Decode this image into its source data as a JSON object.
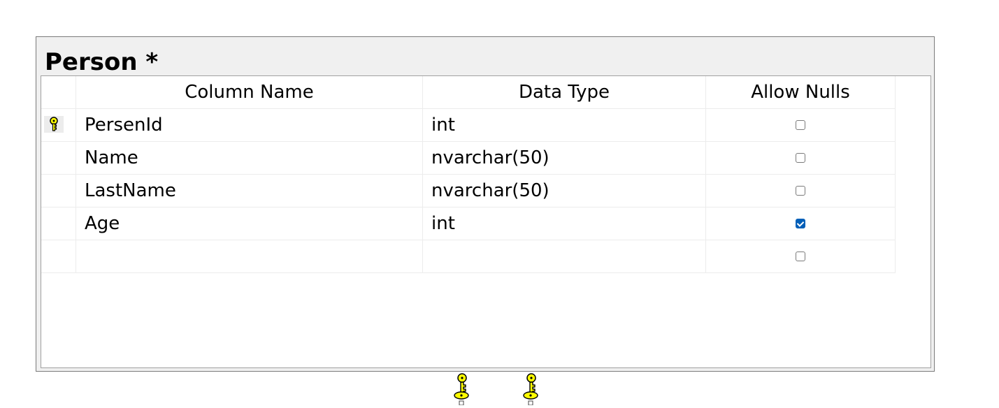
{
  "table": {
    "title": "Person *",
    "columns_header": {
      "name": "Column Name",
      "type": "Data Type",
      "nulls": "Allow Nulls"
    },
    "rows": [
      {
        "name": "PersenId",
        "type": "int",
        "allow_nulls": false,
        "primary_key": true
      },
      {
        "name": "Name",
        "type": "nvarchar(50)",
        "allow_nulls": false,
        "primary_key": false
      },
      {
        "name": "LastName",
        "type": "nvarchar(50)",
        "allow_nulls": false,
        "primary_key": false
      },
      {
        "name": "Age",
        "type": "int",
        "allow_nulls": true,
        "primary_key": false
      },
      {
        "name": "",
        "type": "",
        "allow_nulls": false,
        "primary_key": false
      }
    ]
  },
  "icons": {
    "primary_key": "key-icon",
    "relationship": "key-icon",
    "checked": "checkbox-checked",
    "unchecked": "checkbox-unchecked"
  },
  "colors": {
    "key_yellow": "#ffff00",
    "checkbox_checked": "#005fb8",
    "window_background": "#f0f0f0"
  }
}
